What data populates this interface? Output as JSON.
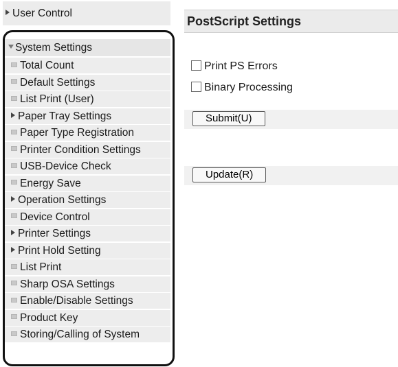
{
  "sidebar": {
    "top_item": "User Control",
    "section_title": "System Settings",
    "items": [
      {
        "label": "Total Count",
        "icon": "doc-icon"
      },
      {
        "label": "Default Settings",
        "icon": "doc-icon"
      },
      {
        "label": "List Print (User)",
        "icon": "doc-icon"
      },
      {
        "label": "Paper Tray Settings",
        "icon": "expand-arrow-icon"
      },
      {
        "label": "Paper Type Registration",
        "icon": "doc-icon"
      },
      {
        "label": "Printer Condition Settings",
        "icon": "doc-icon"
      },
      {
        "label": "USB-Device Check",
        "icon": "doc-icon"
      },
      {
        "label": "Energy Save",
        "icon": "doc-icon"
      },
      {
        "label": "Operation Settings",
        "icon": "expand-arrow-icon"
      },
      {
        "label": "Device Control",
        "icon": "doc-icon"
      },
      {
        "label": "Printer Settings",
        "icon": "expand-arrow-icon"
      },
      {
        "label": "Print Hold Setting",
        "icon": "expand-arrow-icon"
      },
      {
        "label": "List Print",
        "icon": "doc-icon"
      },
      {
        "label": "Sharp OSA Settings",
        "icon": "doc-icon"
      },
      {
        "label": "Enable/Disable Settings",
        "icon": "doc-icon"
      },
      {
        "label": "Product Key",
        "icon": "doc-icon"
      },
      {
        "label": "Storing/Calling of System",
        "icon": "doc-icon"
      }
    ]
  },
  "main": {
    "title": "PostScript Settings",
    "checkboxes": [
      {
        "label": "Print PS Errors",
        "checked": false
      },
      {
        "label": "Binary Processing",
        "checked": false
      }
    ],
    "submit_label": "Submit(U)",
    "update_label": "Update(R)"
  },
  "colors": {
    "sidebar_bg": "#ededed",
    "header_bg": "#ebebeb",
    "highlight_border": "#111111"
  }
}
